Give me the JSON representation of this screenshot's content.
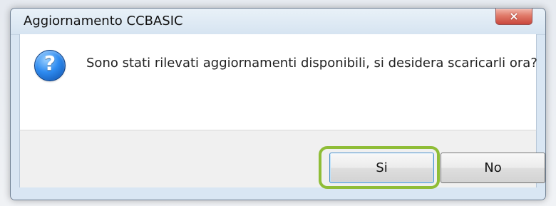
{
  "dialog": {
    "title": "Aggiornamento CCBASIC",
    "close_icon": "close-icon",
    "message_icon": "question-icon",
    "message": "Sono stati rilevati aggiornamenti disponibili, si desidera scaricarli ora?"
  },
  "buttons": {
    "yes": "Si",
    "no": "No"
  },
  "colors": {
    "highlight": "#8fbd37",
    "window_frame": "#d9e6f3",
    "close_button": "#c9483d",
    "question_icon": "#2e8bf0"
  },
  "close_glyph": "×"
}
